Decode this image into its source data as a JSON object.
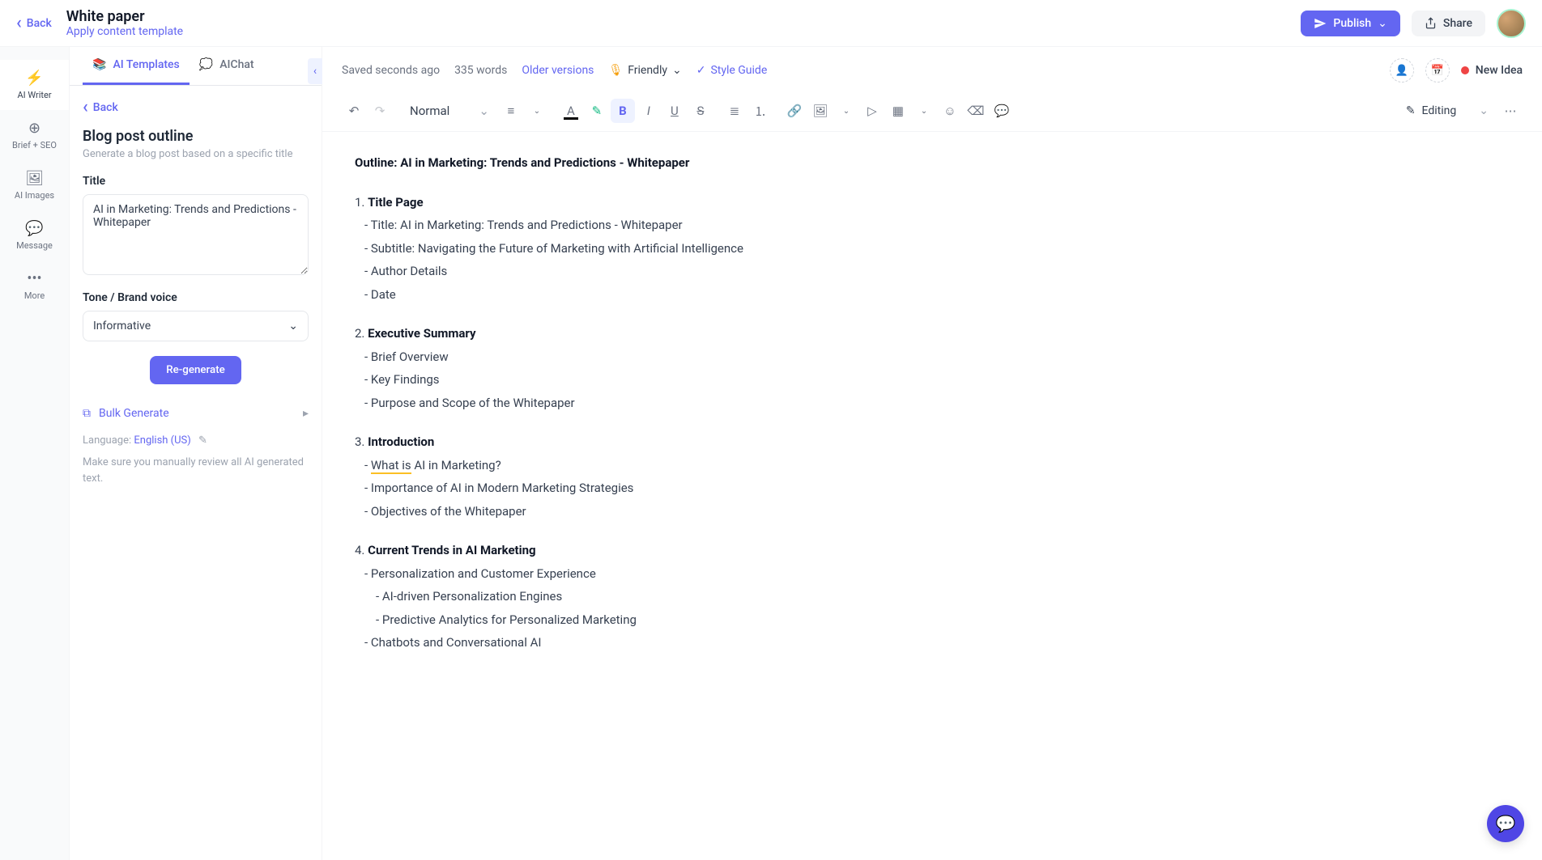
{
  "header": {
    "back": "Back",
    "title": "White paper",
    "apply_template": "Apply content template",
    "publish": "Publish",
    "share": "Share"
  },
  "rail": {
    "ai_writer": "AI Writer",
    "brief_seo": "Brief + SEO",
    "ai_images": "AI Images",
    "message": "Message",
    "more": "More"
  },
  "sidebar": {
    "tabs": {
      "templates": "AI Templates",
      "chat": "AIChat"
    },
    "back": "Back",
    "panel_title": "Blog post outline",
    "panel_desc": "Generate a blog post based on a specific title",
    "title_label": "Title",
    "title_value": "AI in Marketing: Trends and Predictions - Whitepaper",
    "tone_label": "Tone / Brand voice",
    "tone_value": "Informative",
    "regenerate": "Re-generate",
    "bulk": "Bulk Generate",
    "language_label": "Language:",
    "language_value": "English (US)",
    "review_note": "Make sure you manually review all AI generated text."
  },
  "editor_bar": {
    "saved": "Saved seconds ago",
    "words": "335 words",
    "older": "Older versions",
    "tone": "Friendly",
    "style_guide": "Style Guide",
    "status": "New Idea",
    "format": "Normal",
    "editing": "Editing"
  },
  "content": {
    "outline_head": "Outline: AI in Marketing: Trends and Predictions - Whitepaper",
    "sections": [
      {
        "num": "1.",
        "title": "Title Page",
        "items": [
          "Title: AI in Marketing: Trends and Predictions - Whitepaper",
          "Subtitle: Navigating the Future of Marketing with Artificial Intelligence",
          "Author Details",
          "Date"
        ]
      },
      {
        "num": "2.",
        "title": "Executive Summary",
        "items": [
          "Brief Overview",
          "Key Findings",
          "Purpose and Scope of the Whitepaper"
        ]
      },
      {
        "num": "3.",
        "title": "Introduction",
        "items_special": {
          "first_pre": "What is",
          "first_post": " AI in Marketing?",
          "rest": [
            "Importance of AI in Modern Marketing Strategies",
            "Objectives of the Whitepaper"
          ]
        }
      },
      {
        "num": "4.",
        "title": "Current Trends in AI Marketing",
        "items_nested": [
          {
            "text": "Personalization and Customer Experience",
            "children": [
              "AI-driven Personalization Engines",
              "Predictive Analytics for Personalized Marketing"
            ]
          },
          {
            "text": "Chatbots and Conversational AI"
          }
        ]
      }
    ]
  }
}
